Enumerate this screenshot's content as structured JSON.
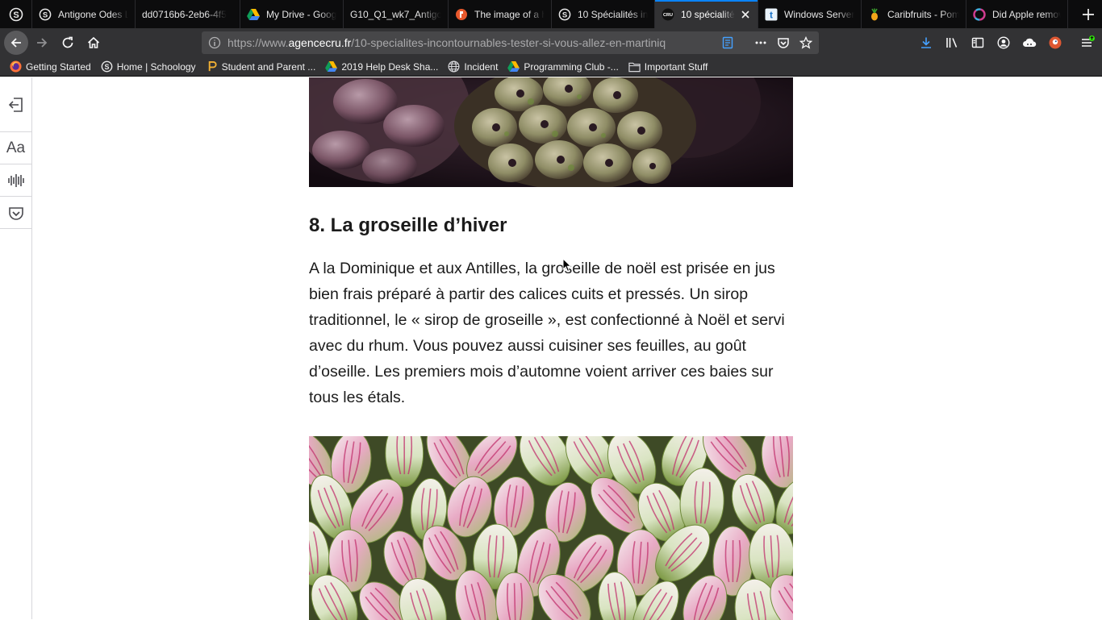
{
  "browser": {
    "tabs": [
      {
        "label": "Antigone Odes L",
        "icon": "schoology-icon"
      },
      {
        "label": "dd0716b6-2eb6-4f5",
        "icon": ""
      },
      {
        "label": "My Drive - Goog",
        "icon": "google-drive-icon"
      },
      {
        "label": "G10_Q1_wk7_Antigon",
        "icon": ""
      },
      {
        "label": "The image of a h",
        "icon": "site-icon"
      },
      {
        "label": "10 Spécialités inc",
        "icon": "schoology-icon"
      },
      {
        "label": "10 spécialités",
        "icon": "agencecru-icon",
        "active": true
      },
      {
        "label": "Windows Server",
        "icon": "windows-server-icon"
      },
      {
        "label": "Caribfruits - Pom",
        "icon": "pineapple-icon"
      },
      {
        "label": "Did Apple remov",
        "icon": "site-icon"
      }
    ],
    "url": {
      "prefix": "https://www.",
      "domain": "agencecru.fr",
      "path": "/10-specialites-incontournables-tester-si-vous-allez-en-martiniq"
    },
    "bookmarks": [
      {
        "label": "Getting Started",
        "icon": "firefox-icon"
      },
      {
        "label": "Home | Schoology",
        "icon": "schoology-icon"
      },
      {
        "label": "Student and Parent ...",
        "icon": "powerschool-icon"
      },
      {
        "label": "2019 Help Desk Sha...",
        "icon": "google-drive-icon"
      },
      {
        "label": "Incident",
        "icon": "globe-icon"
      },
      {
        "label": "Programming Club -...",
        "icon": "google-drive-icon"
      },
      {
        "label": "Important Stuff",
        "icon": "folder-icon"
      }
    ],
    "accent": "#0a84ff"
  },
  "reader": {
    "sidebar": {
      "type_controls_label": "Aa"
    }
  },
  "article": {
    "heading": "8. La groseille d’hiver",
    "paragraph": "A la Dominique et aux Antilles, la groseille de noël est prisée en jus bien frais préparé à partir des calices cuits et pressés. Un sirop traditionnel, le « sirop de groseille », est confectionné à Noël et servi avec du rhum. Vous pouvez aussi cuisiner ses feuilles, au goût d’oseille. Les premiers mois d’automne voient arriver ces baies sur tous les étals."
  }
}
